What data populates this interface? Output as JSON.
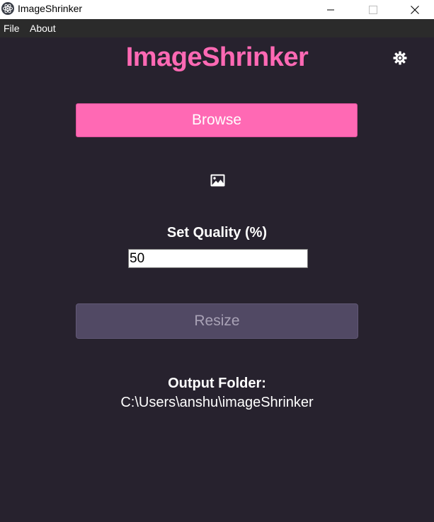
{
  "window": {
    "title": "ImageShrinker"
  },
  "menu": {
    "items": [
      {
        "label": "File"
      },
      {
        "label": "About"
      }
    ]
  },
  "main": {
    "app_title": "ImageShrinker",
    "browse_label": "Browse",
    "quality_label": "Set Quality (%)",
    "quality_value": "50",
    "resize_label": "Resize",
    "output_label": "Output Folder:",
    "output_path": "C:\\Users\\anshu\\imageShrinker"
  },
  "icons": {
    "app": "electron-icon",
    "settings": "gear-icon",
    "image": "image-icon",
    "minimize": "minimize-icon",
    "maximize": "maximize-icon",
    "close": "close-icon"
  },
  "colors": {
    "background": "#27222e",
    "accent": "#ff69b4",
    "resize_button": "#514964",
    "menubar": "#2b2b2b"
  }
}
